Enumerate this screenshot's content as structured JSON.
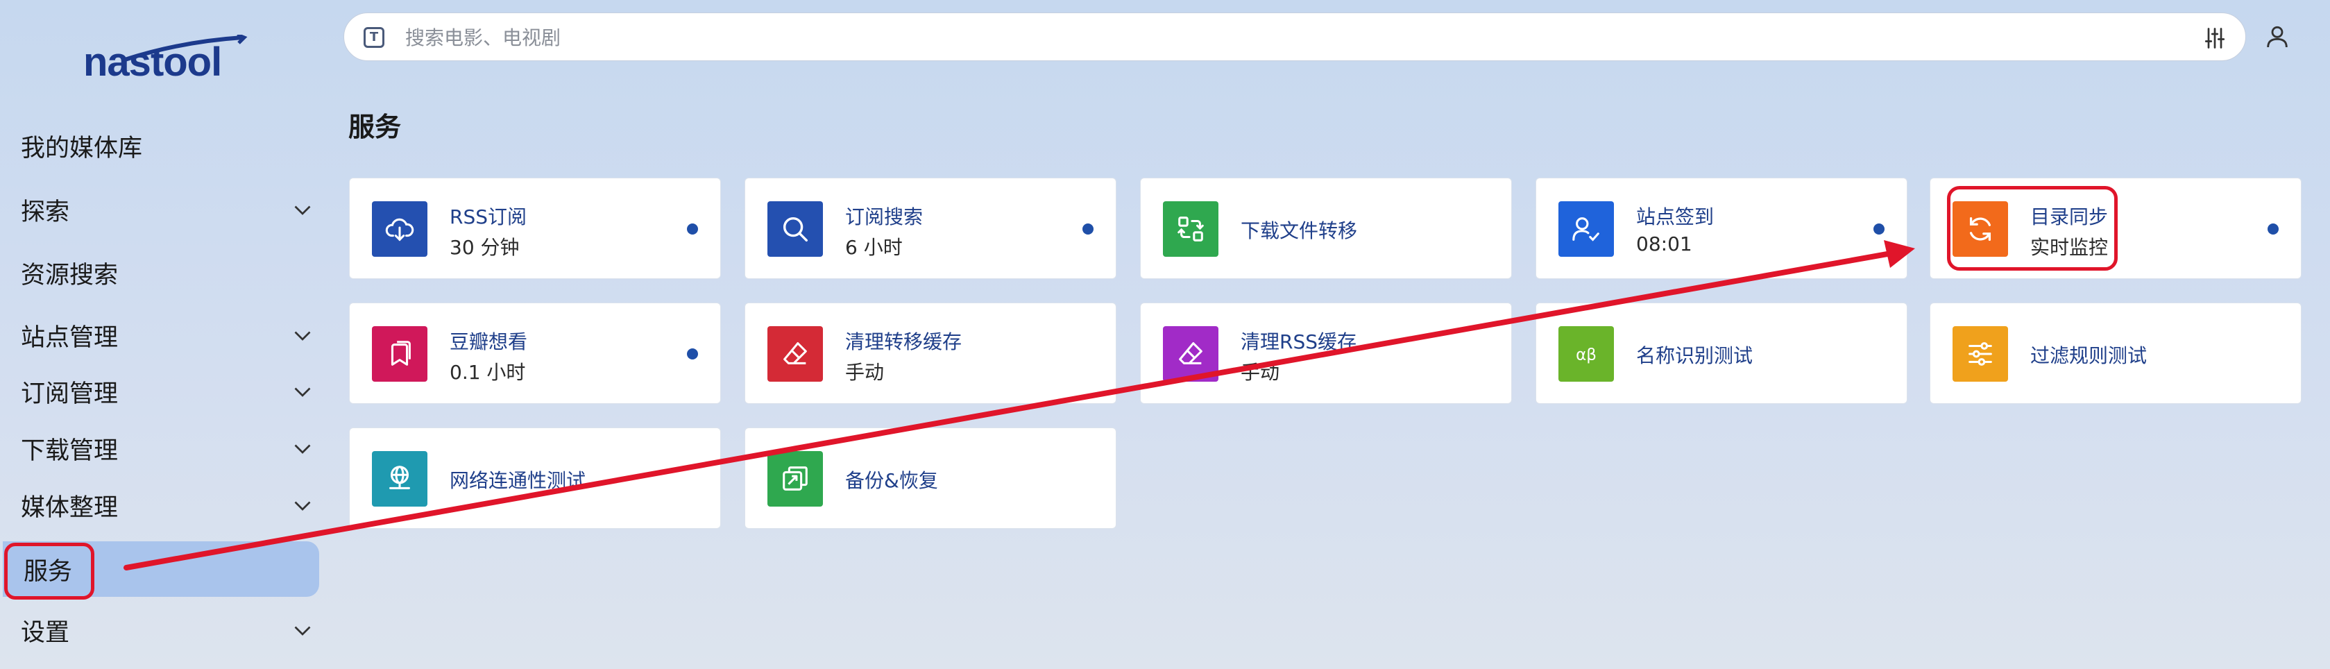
{
  "app": {
    "logo_text": "nastool"
  },
  "search": {
    "placeholder": "搜索电影、电视剧",
    "prefix_icon_letter": "T"
  },
  "sidebar": {
    "items": [
      {
        "label": "我的媒体库",
        "has_chevron": false
      },
      {
        "label": "探索",
        "has_chevron": true
      },
      {
        "label": "资源搜索",
        "has_chevron": false
      },
      {
        "label": "站点管理",
        "has_chevron": true
      },
      {
        "label": "订阅管理",
        "has_chevron": true
      },
      {
        "label": "下载管理",
        "has_chevron": true
      },
      {
        "label": "媒体整理",
        "has_chevron": true
      },
      {
        "label": "服务",
        "has_chevron": false,
        "active": true
      },
      {
        "label": "设置",
        "has_chevron": true
      }
    ]
  },
  "main": {
    "title": "服务",
    "services": [
      {
        "name": "RSS订阅",
        "sub": "30 分钟",
        "icon": "cloud-download-icon",
        "color": "#2450b0",
        "dot": true
      },
      {
        "name": "订阅搜索",
        "sub": "6 小时",
        "icon": "search-icon",
        "color": "#2450b0",
        "dot": true
      },
      {
        "name": "下载文件转移",
        "sub": "",
        "icon": "transfer-icon",
        "color": "#2fa84f",
        "dot": false
      },
      {
        "name": "站点签到",
        "sub": "08:01",
        "icon": "user-check-icon",
        "color": "#1f63db",
        "dot": true
      },
      {
        "name": "目录同步",
        "sub": "实时监控",
        "icon": "refresh-icon",
        "color": "#f26a1b",
        "dot": true
      },
      {
        "name": "豆瓣想看",
        "sub": "0.1 小时",
        "icon": "bookmark-icon",
        "color": "#d0185a",
        "dot": true
      },
      {
        "name": "清理转移缓存",
        "sub": "手动",
        "icon": "eraser-icon",
        "color": "#d42a36",
        "dot": false
      },
      {
        "name": "清理RSS缓存",
        "sub": "手动",
        "icon": "eraser-icon",
        "color": "#a12bc7",
        "dot": false
      },
      {
        "name": "名称识别测试",
        "sub": "",
        "icon": "alpha-beta-icon",
        "color": "#6ab42a",
        "dot": false
      },
      {
        "name": "过滤规则测试",
        "sub": "",
        "icon": "sliders-icon",
        "color": "#f0a11c",
        "dot": false
      },
      {
        "name": "网络连通性测试",
        "sub": "",
        "icon": "network-icon",
        "color": "#1f9ab0",
        "dot": false
      },
      {
        "name": "备份&恢复",
        "sub": "",
        "icon": "backup-icon",
        "color": "#2fa84f",
        "dot": false
      }
    ]
  },
  "annotations": {
    "colors": {
      "highlight": "#e0152a",
      "arrow": "#e0152a"
    }
  }
}
